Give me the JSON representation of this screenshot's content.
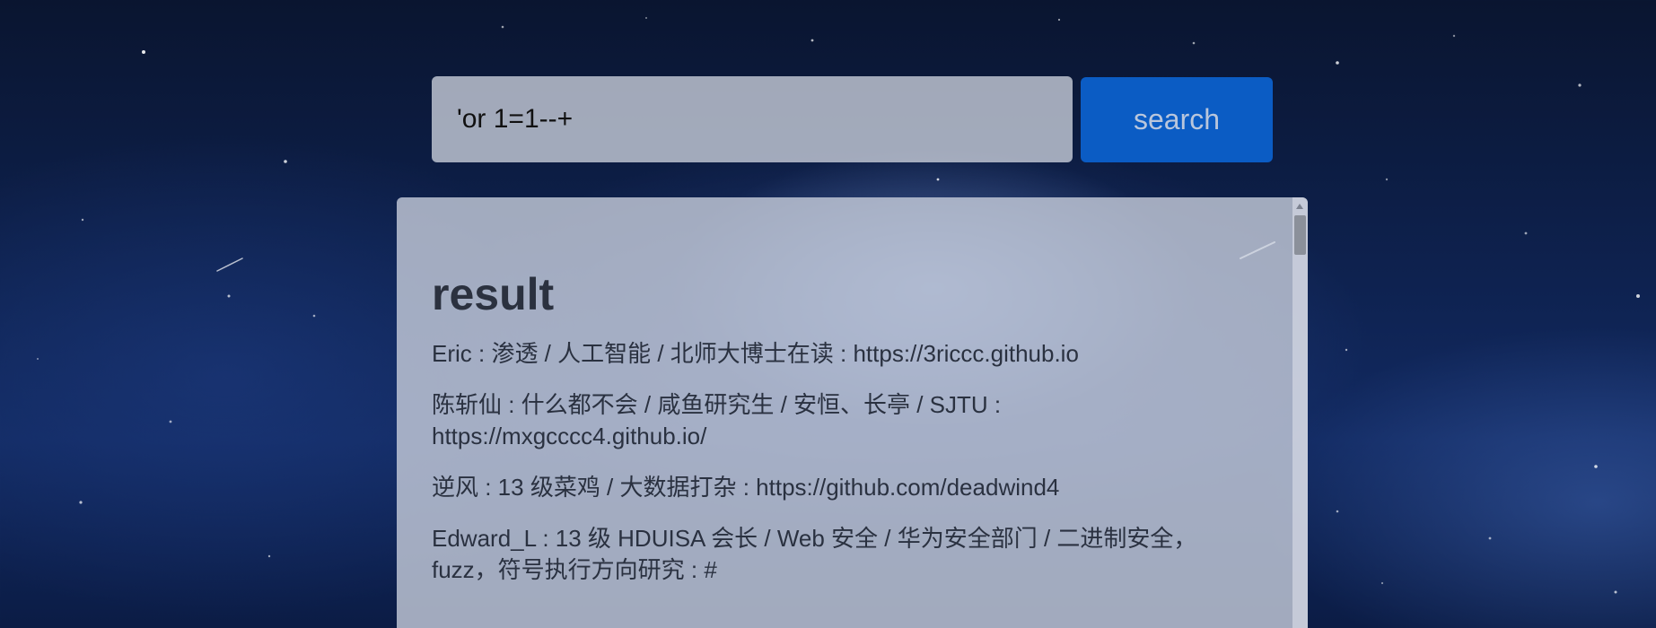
{
  "search": {
    "query_value": "'or 1=1--+",
    "button_label": "search"
  },
  "result": {
    "heading": "result",
    "items": [
      "Eric : 渗透 / 人工智能 / 北师大博士在读 : https://3riccc.github.io",
      "陈斩仙 : 什么都不会 / 咸鱼研究生 / 安恒、长亭 / SJTU : https://mxgcccc4.github.io/",
      "逆风 : 13 级菜鸡 / 大数据打杂 : https://github.com/deadwind4",
      "Edward_L : 13 级 HDUISA 会长 / Web 安全 / 华为安全部门 / 二进制安全，fuzz，符号执行方向研究 : #"
    ]
  },
  "colors": {
    "search_button": "#0b5cc4",
    "panel_background": "#c8cedc",
    "text": "#2a3140"
  }
}
